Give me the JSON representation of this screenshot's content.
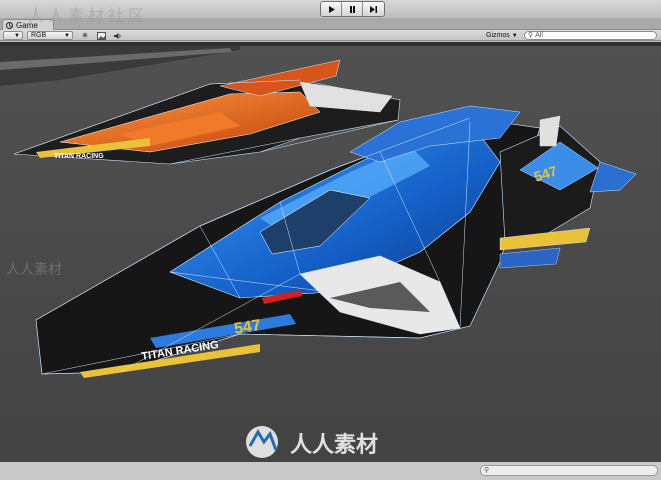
{
  "window": {
    "tab_label": "Game",
    "tab_icon": "unity-logo-icon",
    "watermark_top": "人人素材社区",
    "watermark_bottom": "人人素材"
  },
  "play_controls": {
    "icons": [
      "play-icon",
      "pause-icon",
      "step-icon"
    ]
  },
  "game_toolbar": {
    "display_dropdown": "",
    "color_mode": "RGB",
    "gizmos_label": "Gizmos",
    "search_placeholder": "All"
  },
  "scene": {
    "front_ship": {
      "number": "547",
      "team": "TITAN RACING"
    },
    "back_ship": {
      "team": "TITAN RACING"
    },
    "colors": {
      "background": "#4a4a4a",
      "blue_ship": "#1a6ed8",
      "orange_ship": "#e2611c",
      "wire": "#cfe8ff"
    }
  }
}
